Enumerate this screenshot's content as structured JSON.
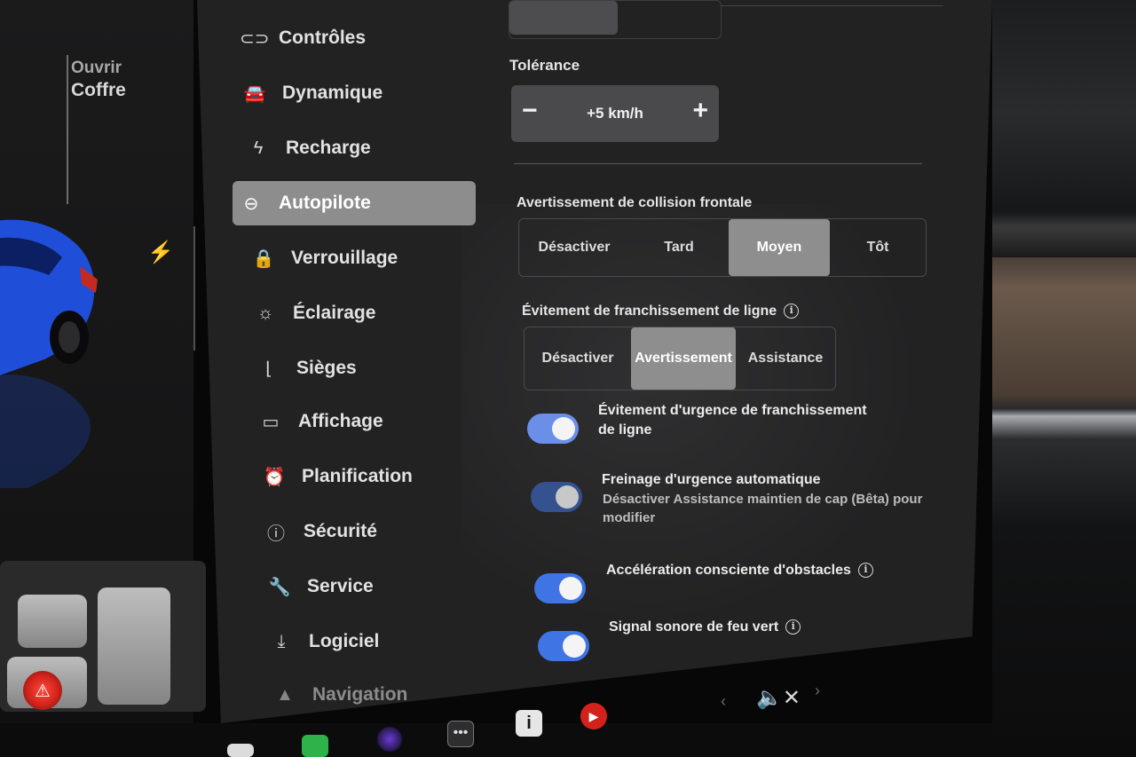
{
  "left_panel": {
    "trunk_action": "Ouvrir",
    "trunk_label": "Coffre",
    "charge_icon": "lightning-icon"
  },
  "sidebar": {
    "items": [
      {
        "label": "Contrôles",
        "icon": "toggle-icon",
        "active": false
      },
      {
        "label": "Dynamique",
        "icon": "car-icon",
        "active": false
      },
      {
        "label": "Recharge",
        "icon": "lightning-icon",
        "active": false
      },
      {
        "label": "Autopilote",
        "icon": "steering-wheel-icon",
        "active": true
      },
      {
        "label": "Verrouillage",
        "icon": "lock-icon",
        "active": false
      },
      {
        "label": "Éclairage",
        "icon": "sun-icon",
        "active": false
      },
      {
        "label": "Sièges",
        "icon": "seat-icon",
        "active": false
      },
      {
        "label": "Affichage",
        "icon": "display-icon",
        "active": false
      },
      {
        "label": "Planification",
        "icon": "alarm-clock-icon",
        "active": false
      },
      {
        "label": "Sécurité",
        "icon": "alert-circle-icon",
        "active": false
      },
      {
        "label": "Service",
        "icon": "wrench-icon",
        "active": false
      },
      {
        "label": "Logiciel",
        "icon": "download-icon",
        "active": false
      },
      {
        "label": "Navigation",
        "icon": "navigation-arrow-icon",
        "active": false
      }
    ]
  },
  "autopilot": {
    "tolerance": {
      "label": "Tolérance",
      "value": "+5 km/h",
      "minus": "−",
      "plus": "+"
    },
    "collision_warning": {
      "label": "Avertissement de collision frontale",
      "options": [
        "Désactiver",
        "Tard",
        "Moyen",
        "Tôt"
      ],
      "selected": "Moyen"
    },
    "lane_departure": {
      "label": "Évitement de franchissement de ligne",
      "info_icon": "info-icon",
      "options": [
        "Désactiver",
        "Avertissement",
        "Assistance"
      ],
      "selected": "Avertissement"
    },
    "toggles": [
      {
        "label": "Évitement d'urgence de franchissement de ligne",
        "on": true
      },
      {
        "label": "Freinage d'urgence automatique",
        "sub": "Désactiver Assistance maintien de cap (Bêta) pour modifier",
        "on": true
      },
      {
        "label": "Accélération consciente d'obstacles",
        "on": true,
        "info": true
      },
      {
        "label": "Signal sonore de feu vert",
        "on": true,
        "info": true
      }
    ]
  },
  "dock": {
    "mute_icon": "speaker-mute-icon",
    "icons": [
      "notes-icon",
      "chart-icon",
      "camera-icon",
      "more-icon",
      "manual-icon",
      "media-player-icon"
    ]
  },
  "colors": {
    "toggle_on": "#3f74e5",
    "active_nav": "#8d8d8e",
    "screen_bg": "#222223"
  }
}
